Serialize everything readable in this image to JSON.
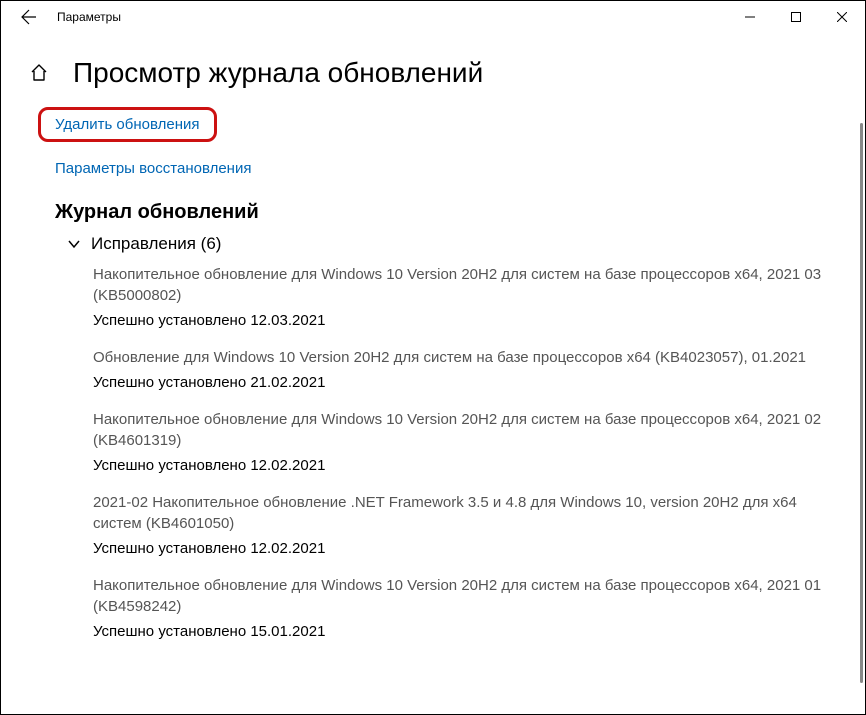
{
  "window": {
    "title": "Параметры"
  },
  "page": {
    "title": "Просмотр журнала обновлений"
  },
  "links": {
    "uninstall": "Удалить обновления",
    "recovery": "Параметры восстановления"
  },
  "history": {
    "heading": "Журнал обновлений",
    "group": {
      "label": "Исправления (6)",
      "count": 6
    },
    "items": [
      {
        "title": "Накопительное обновление для Windows 10 Version 20H2 для систем на базе процессоров x64, 2021 03 (KB5000802)",
        "status": "Успешно установлено 12.03.2021"
      },
      {
        "title": "Обновление для Windows 10 Version 20H2 для систем на базе процессоров x64 (KB4023057), 01.2021",
        "status": "Успешно установлено 21.02.2021"
      },
      {
        "title": "Накопительное обновление для Windows 10 Version 20H2 для систем на базе процессоров x64, 2021 02 (KB4601319)",
        "status": "Успешно установлено 12.02.2021"
      },
      {
        "title": "2021-02 Накопительное обновление .NET Framework 3.5 и 4.8 для Windows 10, version 20H2 для x64 систем (KB4601050)",
        "status": "Успешно установлено 12.02.2021"
      },
      {
        "title": "Накопительное обновление для Windows 10 Version 20H2 для систем на базе процессоров x64, 2021 01 (KB4598242)",
        "status": "Успешно установлено 15.01.2021"
      }
    ]
  }
}
